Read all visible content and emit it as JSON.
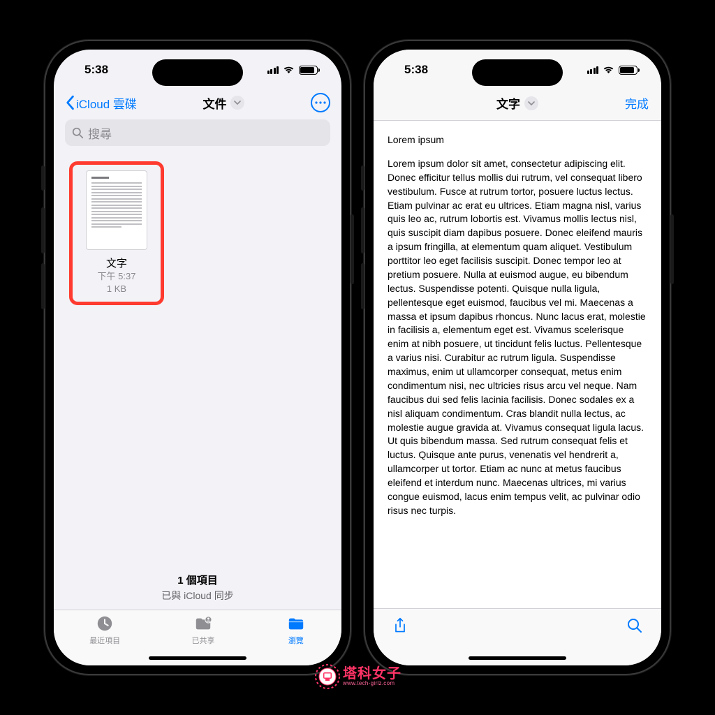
{
  "status": {
    "time": "5:38"
  },
  "screen1": {
    "back_label": "iCloud 雲碟",
    "title": "文件",
    "search_placeholder": "搜尋",
    "file": {
      "name": "文字",
      "time": "下午 5:37",
      "size": "1 KB"
    },
    "summary": {
      "count": "1 個項目",
      "sync": "已與 iCloud 同步"
    },
    "tabs": {
      "recent": "最近項目",
      "shared": "已共享",
      "browse": "瀏覽"
    }
  },
  "screen2": {
    "title": "文字",
    "done": "完成",
    "para1": "Lorem ipsum",
    "para2": "Lorem ipsum dolor sit amet, consectetur adipiscing elit. Donec efficitur tellus mollis dui rutrum, vel consequat libero vestibulum. Fusce at rutrum tortor, posuere luctus lectus. Etiam pulvinar ac erat eu ultrices. Etiam magna nisl, varius quis leo ac, rutrum lobortis est. Vivamus mollis lectus nisl, quis suscipit diam dapibus posuere. Donec eleifend mauris a ipsum fringilla, at elementum quam aliquet. Vestibulum porttitor leo eget facilisis suscipit. Donec tempor leo at pretium posuere. Nulla at euismod augue, eu bibendum lectus. Suspendisse potenti. Quisque nulla ligula, pellentesque eget euismod, faucibus vel mi. Maecenas a massa et ipsum dapibus rhoncus. Nunc lacus erat, molestie in facilisis a, elementum eget est. Vivamus scelerisque enim at nibh posuere, ut tincidunt felis luctus. Pellentesque a varius nisi. Curabitur ac rutrum ligula. Suspendisse maximus, enim ut ullamcorper consequat, metus enim condimentum nisi, nec ultricies risus arcu vel neque. Nam faucibus dui sed felis lacinia facilisis. Donec sodales ex a nisl aliquam condimentum. Cras blandit nulla lectus, ac molestie augue gravida at. Vivamus consequat ligula lacus. Ut quis bibendum massa. Sed rutrum consequat felis et luctus. Quisque ante purus, venenatis vel hendrerit a, ullamcorper ut tortor. Etiam ac nunc at metus faucibus eleifend et interdum nunc. Maecenas ultrices, mi varius congue euismod, lacus enim tempus velit, ac pulvinar odio risus nec turpis."
  },
  "watermark": {
    "main": "塔科女子",
    "sub": "www.tech-girlz.com"
  }
}
